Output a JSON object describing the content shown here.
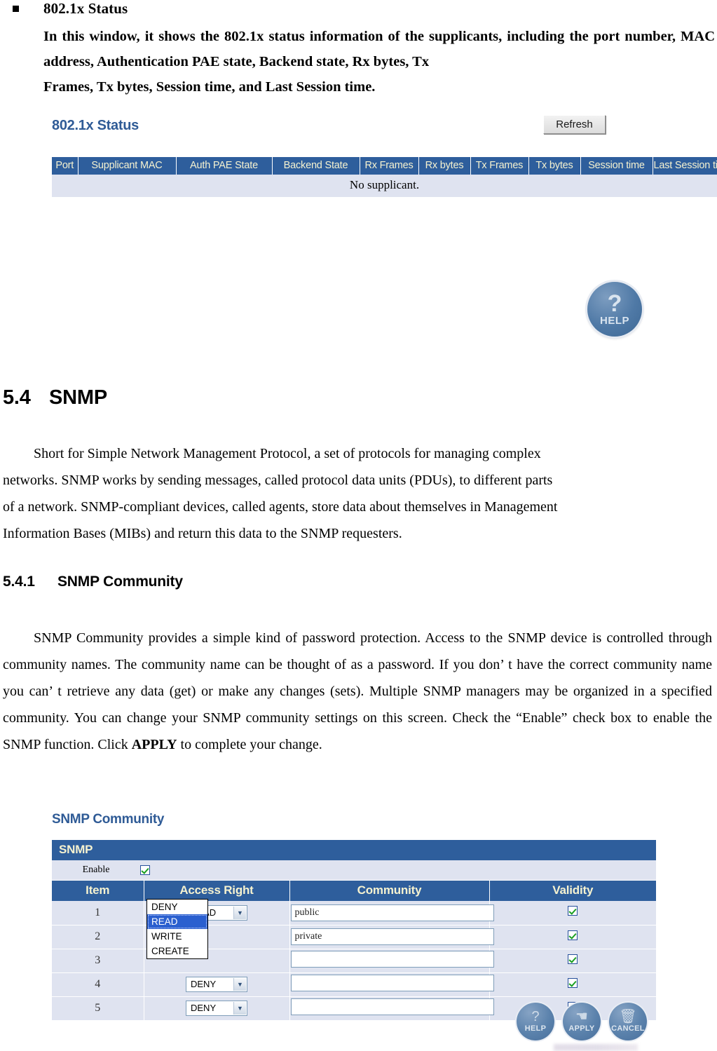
{
  "section_802": {
    "bullet_title": "802.1x Status",
    "body": "In this window, it shows the 802.1x status information of the supplicants, including the port number, MAC address, Authentication PAE state, Backend state, Rx bytes, Tx",
    "body_lastline": "Frames, Tx bytes, Session time, and Last Session time."
  },
  "screenshot_802": {
    "title": "802.1x Status",
    "refresh_label": "Refresh",
    "columns": [
      "Port",
      "Supplicant MAC",
      "Auth PAE State",
      "Backend State",
      "Rx Frames",
      "Rx bytes",
      "Tx Frames",
      "Tx bytes",
      "Session time",
      "Last Session time"
    ],
    "empty_message": "No supplicant.",
    "help_button": {
      "glyph": "?",
      "label": "HELP"
    },
    "header_bg": "#2e5e9c",
    "header_text_color": "#f5f2d0",
    "row_bg": "#dfe3f0"
  },
  "heading_54": {
    "number": "5.4",
    "title": "SNMP"
  },
  "para_snmp": {
    "line1": "Short for Simple Network Management Protocol, a set of protocols for managing complex",
    "line2": "networks. SNMP works by sending messages, called protocol data units (PDUs), to different parts",
    "line3": "of a network. SNMP-compliant devices, called agents, store data about themselves in Management",
    "line4": "Information Bases (MIBs) and return this data to the SNMP requesters."
  },
  "heading_541": {
    "number": "5.4.1",
    "title": "SNMP Community"
  },
  "para_community": {
    "text": "SNMP Community provides a simple kind of password protection. Access to the SNMP device is controlled through community names. The community name can be thought of as a password. If you don’ t have the correct community name you can’ t retrieve any data (get) or make any changes (sets). Multiple SNMP managers may be organized in a specified community. You can change your SNMP community settings on this screen. Check the “Enable” check box to enable the SNMP function. Click ",
    "bold_word": "APPLY",
    "text_tail": " to complete your change."
  },
  "screenshot_snmp": {
    "title": "SNMP Community",
    "panel_header": "SNMP",
    "enable_label": "Enable",
    "enable_checked": true,
    "columns": [
      "Item",
      "Access Right",
      "Community",
      "Validity"
    ],
    "rows": [
      {
        "item": "1",
        "access_right": "READ",
        "community": "public",
        "validity": true
      },
      {
        "item": "2",
        "access_right": "",
        "community": "private",
        "validity": true
      },
      {
        "item": "3",
        "access_right": "",
        "community": "",
        "validity": true
      },
      {
        "item": "4",
        "access_right": "DENY",
        "community": "",
        "validity": true
      },
      {
        "item": "5",
        "access_right": "DENY",
        "community": "",
        "validity": true
      }
    ],
    "open_dropdown": {
      "options": [
        "DENY",
        "READ",
        "WRITE",
        "CREATE"
      ],
      "selected": "READ"
    },
    "buttons": [
      {
        "glyph": "?",
        "label": "HELP"
      },
      {
        "glyph": "☚",
        "label": "APPLY"
      },
      {
        "glyph": "🗑",
        "label": "CANCEL"
      }
    ],
    "header_bg": "#2e5e9c",
    "header_text_color": "#f5f2d0",
    "row_bg": "#dfe3f0",
    "checkbox_color": "#1a9f21"
  }
}
